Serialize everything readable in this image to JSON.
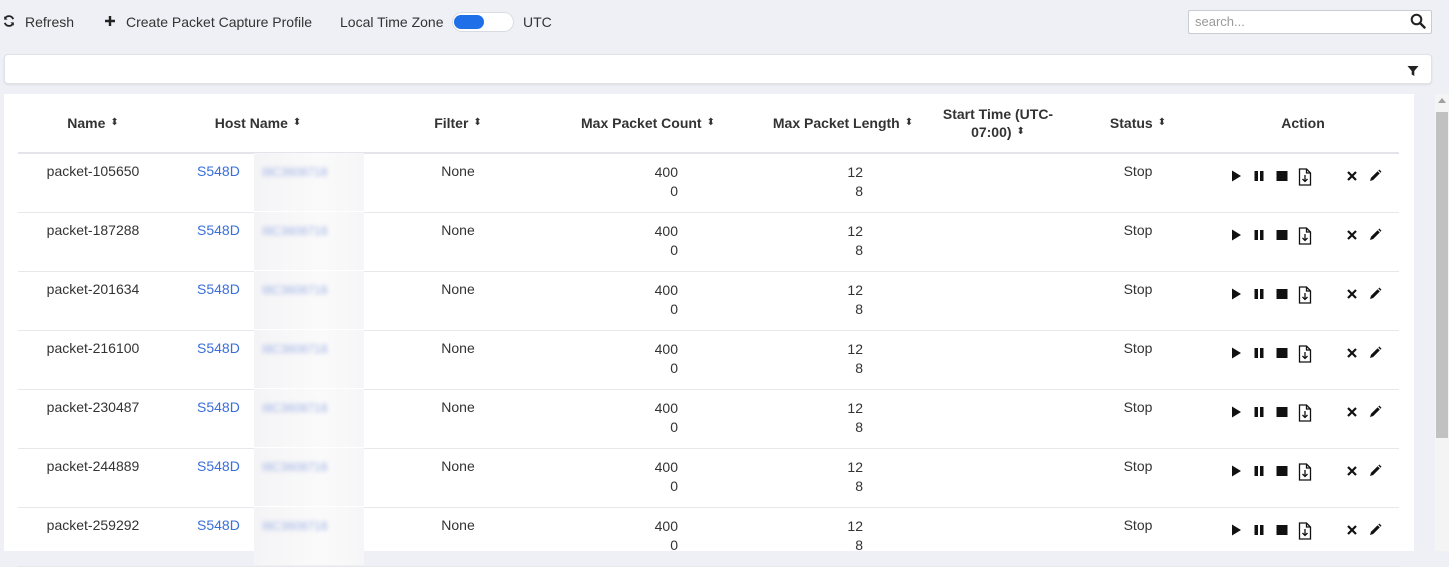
{
  "toolbar": {
    "refresh_label": "Refresh",
    "create_label": "Create Packet Capture Profile",
    "timezone_label": "Local Time Zone",
    "utc_label": "UTC",
    "timezone_toggle_on": true
  },
  "search": {
    "placeholder": "search...",
    "value": ""
  },
  "colors": {
    "accent": "#1e6fe8",
    "link": "#3a6fd8",
    "background": "#eef0f5"
  },
  "table": {
    "columns": {
      "name": "Name",
      "host_name": "Host Name",
      "filter": "Filter",
      "max_packet_count": "Max Packet Count",
      "max_packet_length": "Max Packet Length",
      "start_time_line1": "Start Time (UTC-",
      "start_time_line2": "07:00)",
      "status": "Status",
      "action": "Action"
    },
    "rows": [
      {
        "name": "packet-105650",
        "host": "S548D",
        "host_blurred": "I8C3608718",
        "filter": "None",
        "count_a": "400",
        "count_b": "0",
        "length_a": "12",
        "length_b": "8",
        "start_time": "",
        "status": "Stop"
      },
      {
        "name": "packet-187288",
        "host": "S548D",
        "host_blurred": "I8C3608718",
        "filter": "None",
        "count_a": "400",
        "count_b": "0",
        "length_a": "12",
        "length_b": "8",
        "start_time": "",
        "status": "Stop"
      },
      {
        "name": "packet-201634",
        "host": "S548D",
        "host_blurred": "I8C3608718",
        "filter": "None",
        "count_a": "400",
        "count_b": "0",
        "length_a": "12",
        "length_b": "8",
        "start_time": "",
        "status": "Stop"
      },
      {
        "name": "packet-216100",
        "host": "S548D",
        "host_blurred": "I8C3608718",
        "filter": "None",
        "count_a": "400",
        "count_b": "0",
        "length_a": "12",
        "length_b": "8",
        "start_time": "",
        "status": "Stop"
      },
      {
        "name": "packet-230487",
        "host": "S548D",
        "host_blurred": "I8C3608718",
        "filter": "None",
        "count_a": "400",
        "count_b": "0",
        "length_a": "12",
        "length_b": "8",
        "start_time": "",
        "status": "Stop"
      },
      {
        "name": "packet-244889",
        "host": "S548D",
        "host_blurred": "I8C3608718",
        "filter": "None",
        "count_a": "400",
        "count_b": "0",
        "length_a": "12",
        "length_b": "8",
        "start_time": "",
        "status": "Stop"
      },
      {
        "name": "packet-259292",
        "host": "S548D",
        "host_blurred": "I8C3608718",
        "filter": "None",
        "count_a": "400",
        "count_b": "0",
        "length_a": "12",
        "length_b": "8",
        "start_time": "",
        "status": "Stop"
      }
    ]
  },
  "icons": {
    "refresh": "refresh-icon",
    "create": "plus-icon",
    "search": "search-icon",
    "filter": "filter-icon",
    "actions": [
      "play-icon",
      "pause-icon",
      "stop-icon",
      "download-file-icon",
      "delete-icon",
      "edit-icon"
    ]
  }
}
